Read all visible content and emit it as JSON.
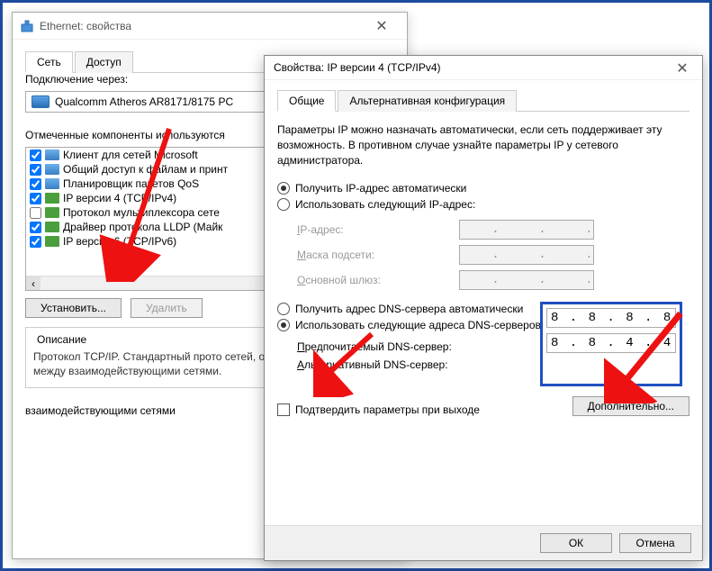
{
  "ethernet_window": {
    "title": "Ethernet: свойства",
    "tabs": {
      "network": "Сеть",
      "access": "Доступ"
    },
    "connect_via_label": "Подключение через:",
    "adapter_name": "Qualcomm Atheros AR8171/8175 PC",
    "components_label": "Отмеченные компоненты используются",
    "components": [
      {
        "checked": true,
        "label": "Клиент для сетей Microsoft",
        "iconClass": "blue"
      },
      {
        "checked": true,
        "label": "Общий доступ к файлам и принт",
        "iconClass": "blue"
      },
      {
        "checked": true,
        "label": "Планировщик пакетов QoS",
        "iconClass": "blue"
      },
      {
        "checked": true,
        "label": "IP версии 4 (TCP/IPv4)",
        "iconClass": ""
      },
      {
        "checked": false,
        "label": "Протокол мультиплексора сете",
        "iconClass": ""
      },
      {
        "checked": true,
        "label": "Драйвер протокола LLDP (Майк",
        "iconClass": ""
      },
      {
        "checked": true,
        "label": "IP версии 6 (TCP/IPv6)",
        "iconClass": ""
      }
    ],
    "install_btn": "Установить...",
    "remove_btn": "Удалить",
    "description_legend": "Описание",
    "description_text": "Протокол TCP/IP. Стандартный прото сетей, обеспечивающий связь между взаимодействующими сетями.",
    "bottom_text": "взаимодействующими сетями"
  },
  "ipv4_window": {
    "title": "Свойства: IP версии 4 (TCP/IPv4)",
    "tabs": {
      "general": "Общие",
      "alternate": "Альтернативная конфигурация"
    },
    "description": "Параметры IP можно назначать автоматически, если сеть поддерживает эту возможность. В противном случае узнайте параметры IP у сетевого администратора.",
    "radio_auto_ip": "Получить IP-адрес автоматически",
    "radio_manual_ip": "Использовать следующий IP-адрес:",
    "ip_label": "IP-адрес:",
    "mask_label": "Маска подсети:",
    "gateway_label": "Основной шлюз:",
    "radio_auto_dns": "Получить адрес DNS-сервера автоматически",
    "radio_manual_dns": "Использовать следующие адреса DNS-серверов:",
    "preferred_dns_label": "Предпочитаемый DNS-сервер:",
    "alternate_dns_label": "Альтернативный DNS-сервер:",
    "preferred_dns_value": "8 . 8 . 8 . 8",
    "alternate_dns_value": "8 . 8 . 4 . 4",
    "validate_label": "Подтвердить параметры при выходе",
    "advanced_btn": "Дополнительно...",
    "ok_btn": "ОК",
    "cancel_btn": "Отмена"
  }
}
